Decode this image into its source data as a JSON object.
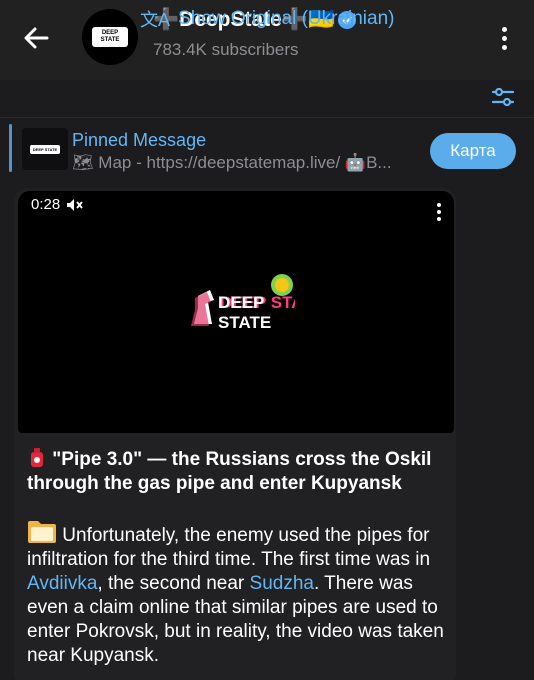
{
  "header": {
    "channel_name": "➕DeepState➕🇺🇦",
    "subscribers": "783.4K subscribers",
    "avatar_text": "DEEP STATE"
  },
  "translate": {
    "label": "Show Original (Ukrainian)"
  },
  "pinned": {
    "title": "Pinned Message",
    "text": "🗺 Map - https://deepstatemap.live/ 🤖B...",
    "button_label": "Карта"
  },
  "video": {
    "time": "0:28",
    "logo_text": "DEEP STATE"
  },
  "message": {
    "title": "\"Pipe 3.0\" — the Russians cross the Oskil through the gas pipe and enter Kupyansk",
    "body_part1": "Unfortunately, the enemy used the pipes for infiltration for the third time. The first time was in ",
    "link1": "Avdiivka",
    "body_part2": ", the second near ",
    "link2": "Sudzha",
    "body_part3": ". There was even a claim online that similar pipes are used to enter Pokrovsk, but in reality, the video was taken near Kupyansk."
  },
  "colors": {
    "accent": "#62b6f5",
    "background": "#1c1c1e",
    "bubble": "#212123"
  }
}
